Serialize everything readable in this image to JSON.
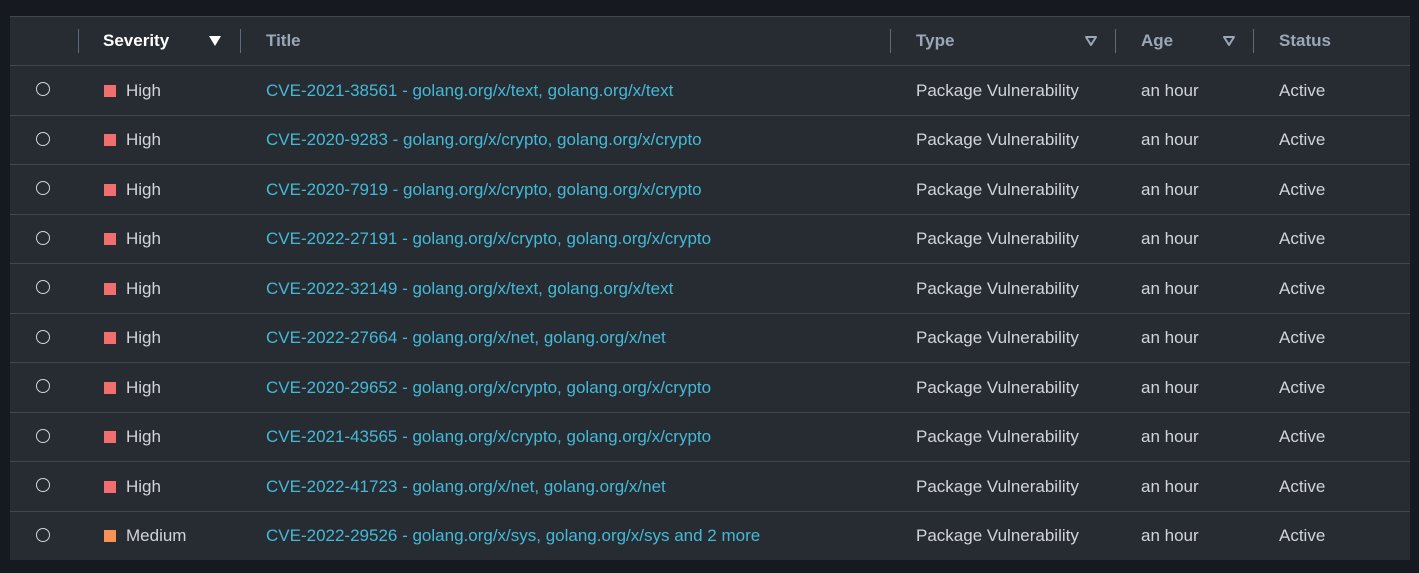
{
  "colors": {
    "high": "#f26d6d",
    "medium": "#f89256",
    "link": "#44b9d6"
  },
  "table": {
    "headers": {
      "severity": "Severity",
      "title": "Title",
      "type": "Type",
      "age": "Age",
      "status": "Status"
    },
    "rows": [
      {
        "severity": "High",
        "title": "CVE-2021-38561 - golang.org/x/text, golang.org/x/text",
        "type": "Package Vulnerability",
        "age": "an hour",
        "status": "Active"
      },
      {
        "severity": "High",
        "title": "CVE-2020-9283 - golang.org/x/crypto, golang.org/x/crypto",
        "type": "Package Vulnerability",
        "age": "an hour",
        "status": "Active"
      },
      {
        "severity": "High",
        "title": "CVE-2020-7919 - golang.org/x/crypto, golang.org/x/crypto",
        "type": "Package Vulnerability",
        "age": "an hour",
        "status": "Active"
      },
      {
        "severity": "High",
        "title": "CVE-2022-27191 - golang.org/x/crypto, golang.org/x/crypto",
        "type": "Package Vulnerability",
        "age": "an hour",
        "status": "Active"
      },
      {
        "severity": "High",
        "title": "CVE-2022-32149 - golang.org/x/text, golang.org/x/text",
        "type": "Package Vulnerability",
        "age": "an hour",
        "status": "Active"
      },
      {
        "severity": "High",
        "title": "CVE-2022-27664 - golang.org/x/net, golang.org/x/net",
        "type": "Package Vulnerability",
        "age": "an hour",
        "status": "Active"
      },
      {
        "severity": "High",
        "title": "CVE-2020-29652 - golang.org/x/crypto, golang.org/x/crypto",
        "type": "Package Vulnerability",
        "age": "an hour",
        "status": "Active"
      },
      {
        "severity": "High",
        "title": "CVE-2021-43565 - golang.org/x/crypto, golang.org/x/crypto",
        "type": "Package Vulnerability",
        "age": "an hour",
        "status": "Active"
      },
      {
        "severity": "High",
        "title": "CVE-2022-41723 - golang.org/x/net, golang.org/x/net",
        "type": "Package Vulnerability",
        "age": "an hour",
        "status": "Active"
      },
      {
        "severity": "Medium",
        "title": "CVE-2022-29526 - golang.org/x/sys, golang.org/x/sys and 2 more",
        "type": "Package Vulnerability",
        "age": "an hour",
        "status": "Active"
      }
    ]
  }
}
